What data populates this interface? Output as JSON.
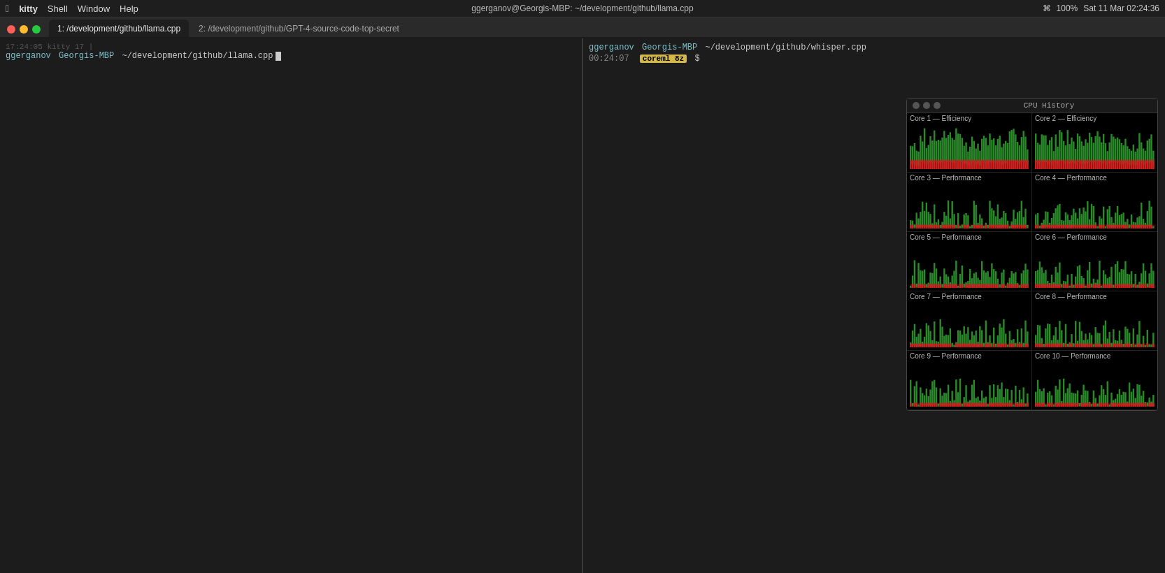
{
  "menubar": {
    "apple": "⌘",
    "app_name": "kitty",
    "menus": [
      "Shell",
      "Window",
      "Help"
    ],
    "center_text": "ggerganov@Georgis-MBP: ~/development/github/llama.cpp",
    "right": {
      "battery": "100%",
      "datetime": "Sat 11 Mar  02:24:36"
    }
  },
  "window": {
    "tabs": [
      {
        "id": "tab1",
        "label": "1: /development/github/llama.cpp",
        "active": true
      },
      {
        "id": "tab2",
        "label": "2: /development/github/GPT-4-source-code-top-secret",
        "active": false
      }
    ]
  },
  "pane_left": {
    "prompt_user": "ggerganov",
    "prompt_host": "Georgis-MBP",
    "prompt_path": "~/development/github/llama.cpp",
    "dim_line": "17:24:05  kitty  17  |"
  },
  "pane_right": {
    "prompt_user": "ggerganov",
    "prompt_host": "Georgis-MBP",
    "prompt_path": "~/development/github/whisper.cpp",
    "time": "00:24:07",
    "badge": "coreml  8z",
    "dollar": "$"
  },
  "cpu_panel": {
    "title": "CPU History",
    "cores": [
      {
        "label": "Core 1 — Efficiency",
        "type": "efficiency"
      },
      {
        "label": "Core 2 — Efficiency",
        "type": "efficiency"
      },
      {
        "label": "Core 3 — Performance",
        "type": "performance"
      },
      {
        "label": "Core 4 — Performance",
        "type": "performance"
      },
      {
        "label": "Core 5 — Performance",
        "type": "performance"
      },
      {
        "label": "Core 6 — Performance",
        "type": "performance"
      },
      {
        "label": "Core 7 — Performance",
        "type": "performance"
      },
      {
        "label": "Core 8 — Performance",
        "type": "performance"
      },
      {
        "label": "Core 9 — Performance",
        "type": "performance"
      },
      {
        "label": "Core 10 — Performance",
        "type": "performance"
      }
    ]
  }
}
